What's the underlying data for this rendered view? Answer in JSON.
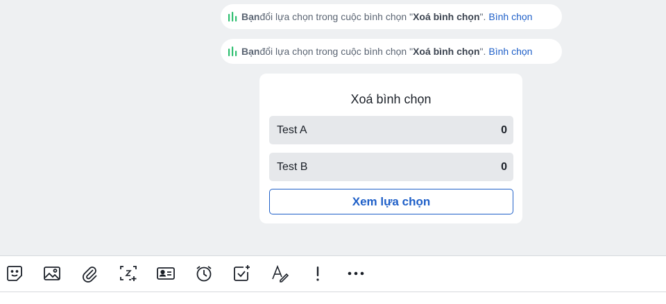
{
  "messages": [
    {
      "actor": "Bạn",
      "text_before": " đổi lựa chọn trong cuộc bình chọn \"",
      "poll_name": "Xoá bình chọn",
      "text_after": "\".",
      "link": "Bình chọn",
      "icon": "poll-bars-icon"
    },
    {
      "actor": "Bạn",
      "text_before": " đổi lựa chọn trong cuộc bình chọn \"",
      "poll_name": "Xoá bình chọn",
      "text_after": "\".",
      "link": "Bình chọn",
      "icon": "poll-bars-icon"
    }
  ],
  "poll": {
    "title": "Xoá bình chọn",
    "options": [
      {
        "label": "Test A",
        "count": "0"
      },
      {
        "label": "Test B",
        "count": "0"
      }
    ],
    "button_label": "Xem lựa chọn"
  },
  "toolbar": {
    "icons": [
      "sticker-icon",
      "image-icon",
      "attachment-icon",
      "screenshot-icon",
      "contact-card-icon",
      "reminder-clock-icon",
      "task-icon",
      "text-format-icon",
      "urgent-icon",
      "more-icon"
    ]
  },
  "colors": {
    "accent": "#1e5fc8",
    "poll_icon": "#2fbf71",
    "background": "#eef0f2"
  }
}
